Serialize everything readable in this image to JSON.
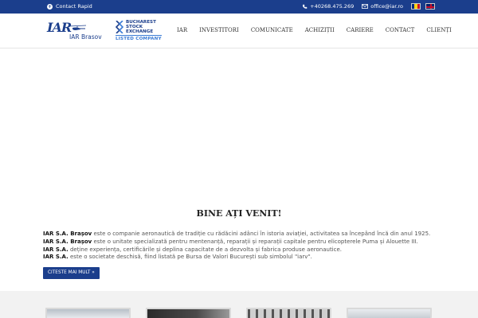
{
  "topbar": {
    "contact_label": "Contact Rapid",
    "phone": "+40268.475.269",
    "email": "office@iar.ro"
  },
  "header": {
    "logo_mark": "IAR",
    "logo_name": "IAR Brasov",
    "bse_line1": "BUCHAREST",
    "bse_line2": "STOCK",
    "bse_line3": "EXCHANGE",
    "bse_listed": "LISTED COMPANY"
  },
  "nav": {
    "items": [
      "IAR",
      "INVESTITORI",
      "COMUNICATE",
      "ACHIZIȚII",
      "CARIERE",
      "CONTACT",
      "CLIENȚI"
    ]
  },
  "welcome": {
    "title": "BINE AȚI VENIT!",
    "lines": [
      {
        "bold": "IAR S.A. Brașov",
        "text": " este o companie aeronautică de tradiție cu rădăcini adânci în istoria aviației, activitatea sa începând încă din anul 1925."
      },
      {
        "bold": "IAR S.A. Brașov",
        "text": " este o unitate specializată pentru mentenanță, reparații și reparații capitale pentru elicopterele Puma și Alouette III."
      },
      {
        "bold": "IAR S.A.",
        "text": " deține experiența, certificările și deplina capacitate de a dezvolta și fabrica produse aeronautice."
      },
      {
        "bold": "IAR S.A.",
        "text": " este o societate deschisă, fiind listată pe Bursa de Valori București sub simbolul \"iarv\"."
      }
    ],
    "button_label": "CITESTE MAI MULT »"
  },
  "colors": {
    "brand": "#1b3e8c",
    "accent": "#3a7bd5"
  }
}
